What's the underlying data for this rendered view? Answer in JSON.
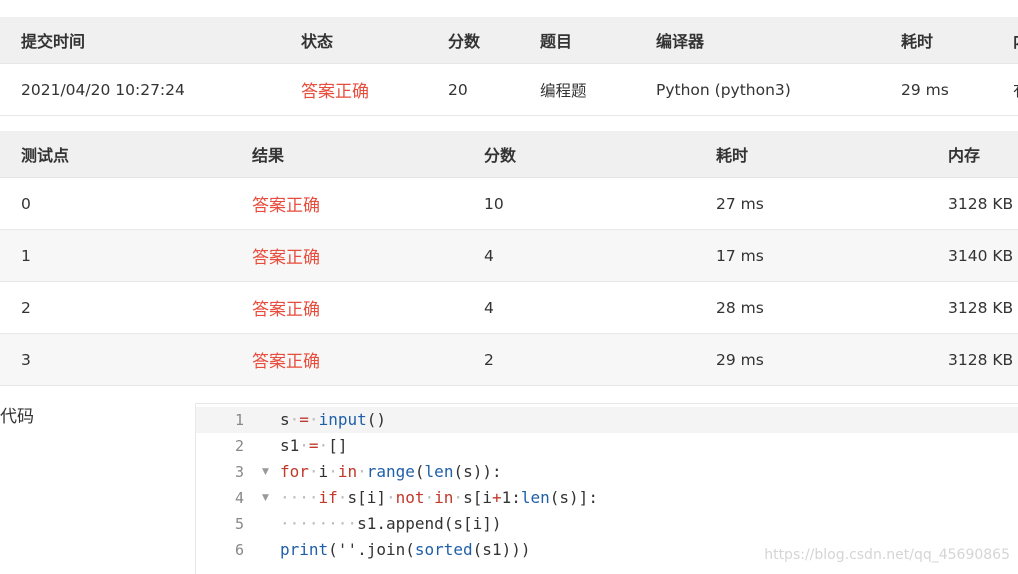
{
  "submission": {
    "headers": [
      "提交时间",
      "状态",
      "分数",
      "题目",
      "编译器",
      "耗时",
      "内"
    ],
    "values": [
      "2021/04/20 10:27:24",
      "答案正确",
      "20",
      "编程题",
      "Python (python3)",
      "29 ms",
      "有"
    ]
  },
  "testcases": {
    "headers": [
      "测试点",
      "结果",
      "分数",
      "耗时",
      "内存"
    ],
    "rows": [
      [
        "0",
        "答案正确",
        "10",
        "27 ms",
        "3128 KB"
      ],
      [
        "1",
        "答案正确",
        "4",
        "17 ms",
        "3140 KB"
      ],
      [
        "2",
        "答案正确",
        "4",
        "28 ms",
        "3128 KB"
      ],
      [
        "3",
        "答案正确",
        "2",
        "29 ms",
        "3128 KB"
      ]
    ]
  },
  "code": {
    "label": "代码",
    "line_numbers": [
      "1",
      "2",
      "3",
      "4",
      "5",
      "6"
    ],
    "lines": [
      "s = input()",
      "s1 = []",
      "for i in range(len(s)):",
      "    if s[i] not in s[i+1:len(s)]:",
      "        s1.append(s[i])",
      "print(''.join(sorted(s1)))"
    ],
    "fold_icon": "▼"
  },
  "watermark": "https://blog.csdn.net/qq_45690865",
  "colors": {
    "status_ok": "#e74c3c",
    "keyword": "#c0392b",
    "builtin": "#1f5fa8"
  }
}
